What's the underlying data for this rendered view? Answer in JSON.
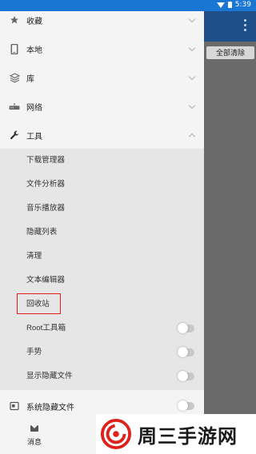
{
  "status_bar": {
    "time": "5:39"
  },
  "toolbar": {
    "clear_all_label": "全部清除"
  },
  "drawer": {
    "sections": [
      {
        "label": "收藏",
        "icon": "star-icon"
      },
      {
        "label": "本地",
        "icon": "phone-icon"
      },
      {
        "label": "库",
        "icon": "layers-icon"
      },
      {
        "label": "网络",
        "icon": "router-icon"
      },
      {
        "label": "工具",
        "icon": "wrench-icon"
      }
    ],
    "tools": [
      {
        "label": "下载管理器"
      },
      {
        "label": "文件分析器"
      },
      {
        "label": "音乐播放器"
      },
      {
        "label": "隐藏列表"
      },
      {
        "label": "清理"
      },
      {
        "label": "文本编辑器"
      },
      {
        "label": "回收站"
      },
      {
        "label": "Root工具箱",
        "toggle": false
      },
      {
        "label": "手势",
        "toggle": false
      },
      {
        "label": "显示隐藏文件",
        "toggle": false
      }
    ],
    "system_hidden": {
      "label": "系统隐藏文件",
      "toggle": false
    },
    "messages": {
      "label": "消息",
      "icon": "mail-icon"
    }
  },
  "watermark": {
    "text": "周三手游网"
  },
  "colors": {
    "status_bar": "#1976d2",
    "app_bar": "#1f4f88",
    "drawer": "#f4f4f4",
    "sub_panel": "#e6e6e6",
    "highlight": "#e0201b",
    "logo": "#e0201b"
  }
}
